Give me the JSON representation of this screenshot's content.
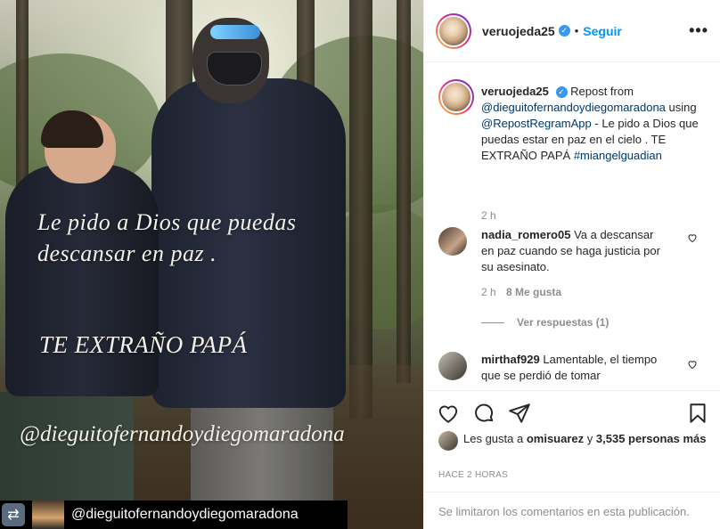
{
  "photo": {
    "overlay_line1": "Le pido a Dios que puedas",
    "overlay_line2": "descansar en paz .",
    "overlay_line3": "TE EXTRAÑO PAPÁ",
    "overlay_handle": "@dieguitofernandoydiegomaradona",
    "repost_bar_name": "@dieguitofernandoydiegomaradona"
  },
  "header": {
    "username": "veruojeda25",
    "dot": "•",
    "follow_label": "Seguir",
    "more_label": "•••"
  },
  "caption": {
    "username": "veruojeda25",
    "text_1": "Repost from",
    "mention_1": "@dieguitofernandoydiegomaradona",
    "text_2": "using",
    "mention_2": "@RepostRegramApp",
    "text_3": "- Le pido a Dios que puedas estar en paz en el cielo . TE EXTRAÑO PAPÁ",
    "hashtag": "#miangelguadian",
    "time": "2 h"
  },
  "comments": [
    {
      "username": "nadia_romero05",
      "text": "Va a descansar en paz cuando se haga justicia por su asesinato.",
      "time": "2 h",
      "likes": "8 Me gusta",
      "replies_label": "Ver respuestas (1)"
    },
    {
      "username": "mirthaf929",
      "text": "Lamentable, el tiempo que se perdió de tomar"
    }
  ],
  "likes": {
    "prefix": "Les gusta a",
    "user": "omisuarez",
    "connector": "y",
    "count": "3,535 personas más"
  },
  "time_ago": "HACE 2 HORAS",
  "comments_limited": "Se limitaron los comentarios en esta publicación.",
  "colors": {
    "link_blue": "#0095f6",
    "mention": "#00376b",
    "muted": "#8e8e8e",
    "verified": "#3897f0"
  }
}
